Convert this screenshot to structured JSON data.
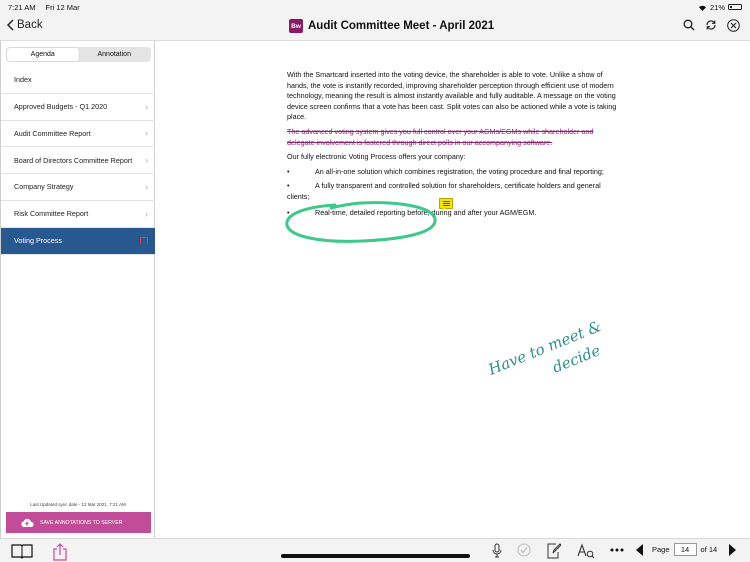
{
  "status": {
    "time": "7:21 AM",
    "date": "Fri 12 Mar",
    "battery": "21%"
  },
  "nav": {
    "back_label": "Back",
    "title": "Audit Committee Meet - April 2021",
    "app_badge": "Bw"
  },
  "sidebar": {
    "tabs": [
      {
        "label": "Agenda",
        "active": true
      },
      {
        "label": "Annotation",
        "active": false
      }
    ],
    "items": [
      {
        "label": "Index"
      },
      {
        "label": "Approved Budgets - Q1 2020"
      },
      {
        "label": "Audit Committee Report"
      },
      {
        "label": "Board of Directors Committee Report"
      },
      {
        "label": "Company Strategy"
      },
      {
        "label": "Risk Committee Report"
      },
      {
        "label": "Voting Process"
      }
    ],
    "sync_text": "Last Updated sync date - 12 Mar 2021, 7:21 AM",
    "save_button_label": "SAVE ANNOTATIONS TO SERVER"
  },
  "document": {
    "paragraph1": "With the Smartcard inserted into the voting device, the shareholder is able to vote. Unlike a show of hands, the vote is instantly recorded, improving shareholder perception through efficient use of modern technology, meaning the result is almost instantly available and fully auditable. A message on the voting device screen confirms that a vote has been cast. Split votes can also be actioned while a vote is taking place.",
    "strikethrough": "The advanced voting system gives you full control over your AGMs/EGMs while shareholder and delegate involvement is fostered through direct polls in our accompanying software.",
    "intro": "Our fully electronic Voting Process offers your company:",
    "bullet_symbol": "•",
    "bullets": [
      "An all-in-one solution which combines registration, the voting procedure and final reporting;",
      "A fully transparent and controlled solution for shareholders, certificate holders and general clients;",
      "Real-time, detailed reporting before, during and after your AGM/EGM."
    ],
    "handwritten_note": "Have to meet & decide",
    "annotation_color": "#3ec98a",
    "strike_color": "#8a2670"
  },
  "toolbar": {
    "page_label": "Page",
    "current_page": "14",
    "total_label": "of 14"
  },
  "colors": {
    "selected_item": "#27588f",
    "save_button": "#c14d98",
    "app_badge": "#8b1a64"
  }
}
